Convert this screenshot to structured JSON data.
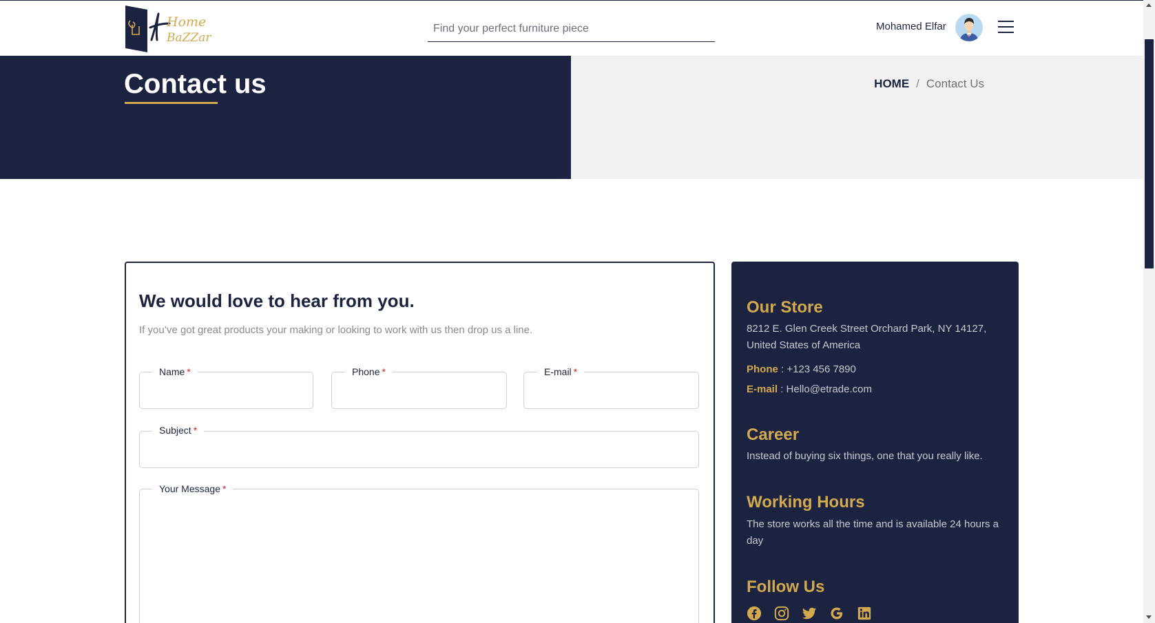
{
  "header": {
    "logo_text_1": "Home",
    "logo_text_2": "BaZZar",
    "search_placeholder": "Find your perfect furniture piece",
    "user_name": "Mohamed Elfar"
  },
  "banner": {
    "title": "Contact us",
    "breadcrumb": {
      "home": "HOME",
      "separator": "/",
      "current": "Contact Us"
    }
  },
  "form": {
    "heading": "We would love to hear from you.",
    "subtitle": "If you’ve got great products your making or looking to work with us then drop us a line.",
    "required_mark": "*",
    "fields": {
      "name": {
        "label": "Name",
        "value": ""
      },
      "phone": {
        "label": "Phone",
        "value": ""
      },
      "email": {
        "label": "E-mail",
        "value": ""
      },
      "subject": {
        "label": "Subject",
        "value": ""
      },
      "message": {
        "label": "Your Message",
        "value": ""
      }
    }
  },
  "info": {
    "store_title": "Our Store",
    "store_address": "8212 E. Glen Creek Street Orchard Park, NY 14127, United States of America",
    "phone_label": "Phone",
    "phone_value": " : +123 456 7890",
    "email_label": "E-mail",
    "email_value": " : Hello@etrade.com",
    "career_title": "Career",
    "career_text": "Instead of buying six things, one that you really like.",
    "hours_title": "Working Hours",
    "hours_text": "The store works all the time and is available 24 hours a day",
    "follow_title": "Follow Us",
    "socials": [
      "facebook-icon",
      "instagram-icon",
      "twitter-icon",
      "google-icon",
      "linkedin-icon"
    ]
  },
  "colors": {
    "navy": "#1c2340",
    "gold": "#d2a94e",
    "light_gray": "#f1f1f1",
    "required_red": "#e01e1e"
  }
}
